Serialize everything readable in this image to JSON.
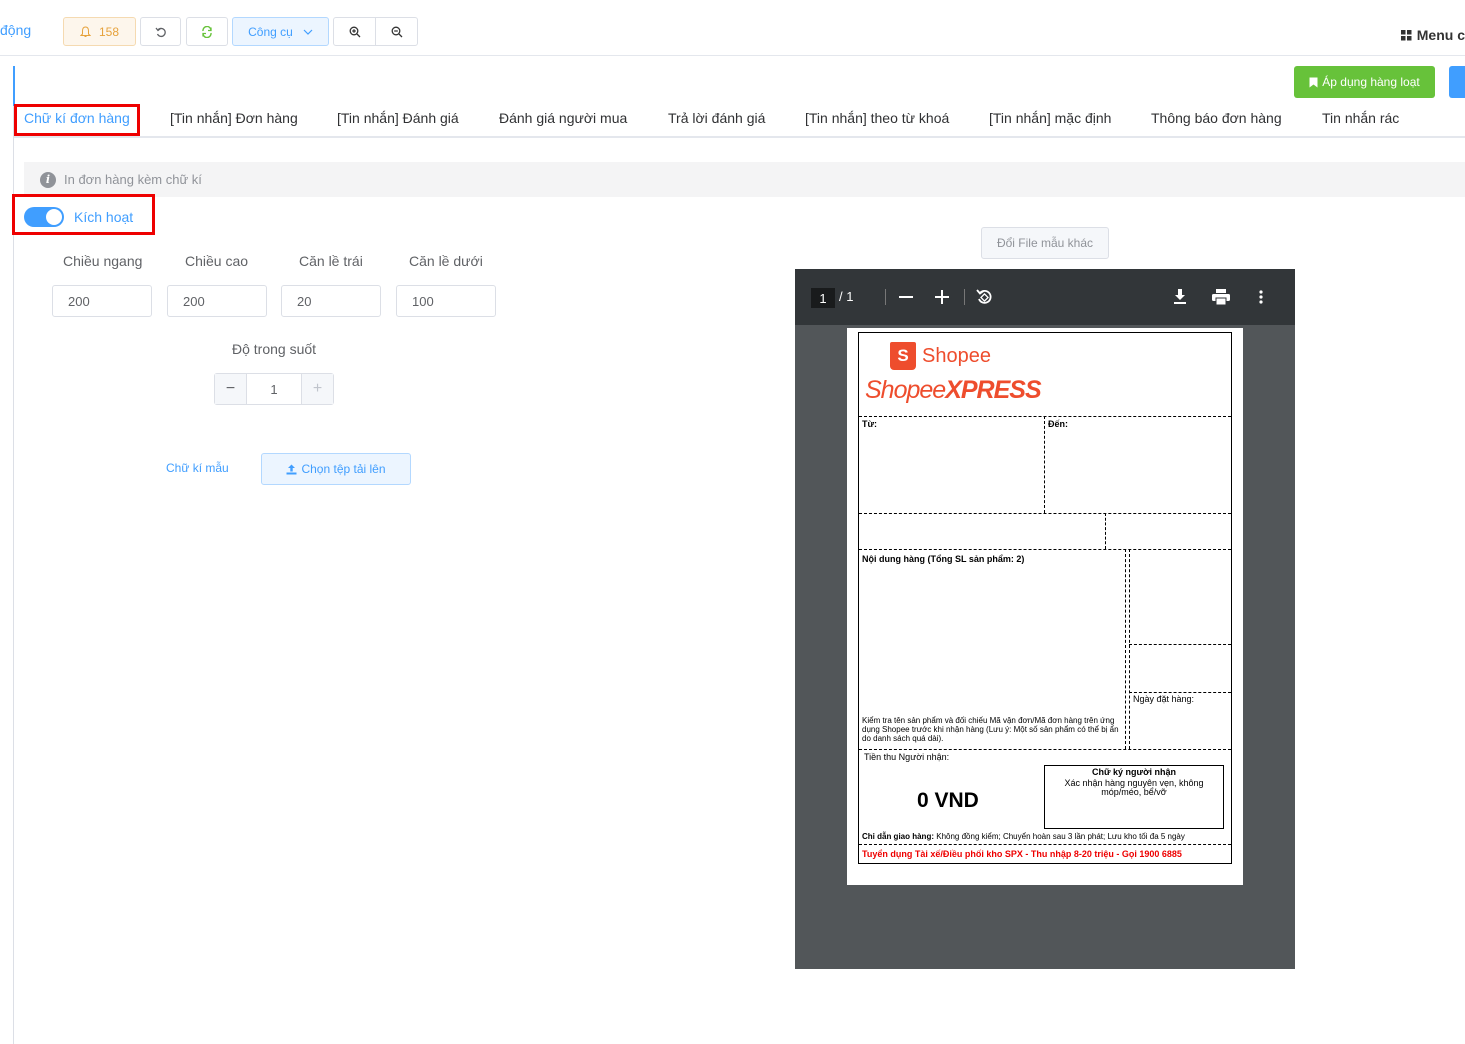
{
  "topbar": {
    "left_link": "động",
    "notif_count": "158",
    "tools_label": "Công cụ",
    "menu_label": "Menu c"
  },
  "actions": {
    "apply_bulk": "Áp dụng hàng loạt"
  },
  "tabs": [
    {
      "label": "Chữ kí đơn hàng"
    },
    {
      "label": "[Tin nhắn] Đơn hàng"
    },
    {
      "label": "[Tin nhắn] Đánh giá"
    },
    {
      "label": "Đánh giá người mua"
    },
    {
      "label": "Trả lời đánh giá"
    },
    {
      "label": "[Tin nhắn] theo từ khoá"
    },
    {
      "label": "[Tin nhắn] mặc định"
    },
    {
      "label": "Thông báo đơn hàng"
    },
    {
      "label": "Tin nhắn rác"
    }
  ],
  "info": {
    "text": "In đơn hàng kèm chữ kí"
  },
  "activate": {
    "label": "Kích hoạt",
    "enabled": true
  },
  "fields": {
    "width": {
      "label": "Chiều ngang",
      "value": "200"
    },
    "height": {
      "label": "Chiều cao",
      "value": "200"
    },
    "margin_left": {
      "label": "Căn lề trái",
      "value": "20"
    },
    "margin_bottom": {
      "label": "Căn lề dưới",
      "value": "100"
    },
    "opacity": {
      "label": "Độ trong suốt",
      "value": "1"
    }
  },
  "sample_sig": "Chữ kí mẫu",
  "upload": "Chọn tệp tải lên",
  "change_file": "Đổi File mẫu khác",
  "viewer": {
    "page_current": "1",
    "page_total": "/ 1"
  },
  "label": {
    "brand": "Shopee",
    "brand_bag": "S",
    "express_a": "Shopee",
    "express_b": "XPRESS",
    "from": "Từ:",
    "to": "Đến:",
    "contents": "Nội dung hàng (Tổng SL sản phẩm: 2)",
    "check_note": "Kiểm tra tên sản phẩm và đối chiếu Mã vận đơn/Mã đơn hàng trên ứng dụng Shopee trước khi nhận hàng (Lưu ý: Một số sản phẩm có thể bị ẩn do danh sách quá dài).",
    "order_date": "Ngày đặt hàng:",
    "cod_label": "Tiền thu Người nhận:",
    "cod_value": "0 VND",
    "sig_title": "Chữ ký người nhận",
    "sig_note": "Xác nhận hàng nguyên vẹn, không móp/méo, bể/vỡ",
    "delivery_label": "Chỉ dẫn giao hàng:",
    "delivery_text": "Không đồng kiểm; Chuyển hoàn sau 3 lần phát; Lưu kho tối đa 5 ngày",
    "recruit": "Tuyển dụng Tài xế/Điều phối kho SPX - Thu nhập 8-20 triệu - Gọi 1900 6885"
  },
  "colors": {
    "primary": "#409eff",
    "success": "#67c23a",
    "warning": "#e6a23c",
    "highlight": "#ee0000",
    "shopee": "#ee4d2d"
  }
}
